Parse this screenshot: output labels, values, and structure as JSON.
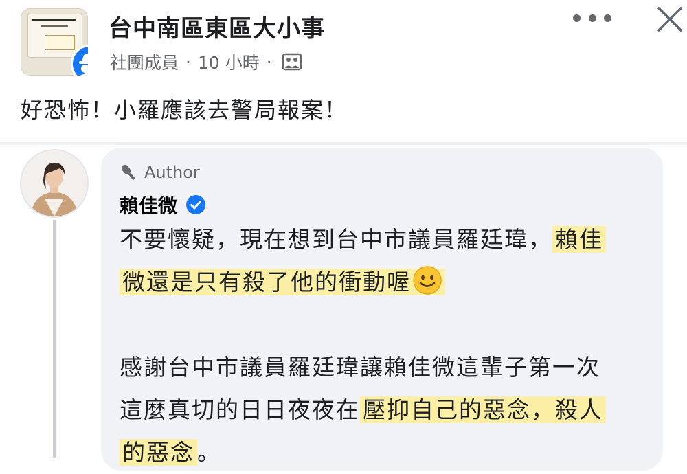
{
  "header": {
    "group_name": "台中南區東區大小事",
    "member_role": "社團成員",
    "separator": "·",
    "time_ago": "10 小時",
    "more_icon": "more-horizontal-icon",
    "close_icon": "close-icon",
    "privacy_icon": "photo-icon"
  },
  "post": {
    "text": "好恐怖！小羅應該去警局報案！"
  },
  "comment": {
    "author_label": "Author",
    "author_icon": "microphone-icon",
    "name": "賴佳微",
    "verified_icon": "verified-badge-icon",
    "lines": [
      {
        "plain": "不要懷疑，現在想到台中市議員羅廷瑋，",
        "highlight": "賴佳"
      },
      {
        "plain": "",
        "highlight": "微還是只有殺了他的衝動喔"
      },
      {
        "plain": "",
        "highlight": ""
      },
      {
        "plain": "感謝台中市議員羅廷瑋讓賴佳微這輩子第一次",
        "highlight": ""
      },
      {
        "plain": "這麼真切的日日夜夜在",
        "highlight": "壓抑自己的惡念，殺人"
      },
      {
        "plain": "",
        "highlight": "的惡念",
        "after": "。"
      }
    ]
  },
  "colors": {
    "highlight": "#fbefa6",
    "facebook_blue": "#1877f2",
    "bubble": "#f0f2f5",
    "meta_text": "#65676b"
  }
}
